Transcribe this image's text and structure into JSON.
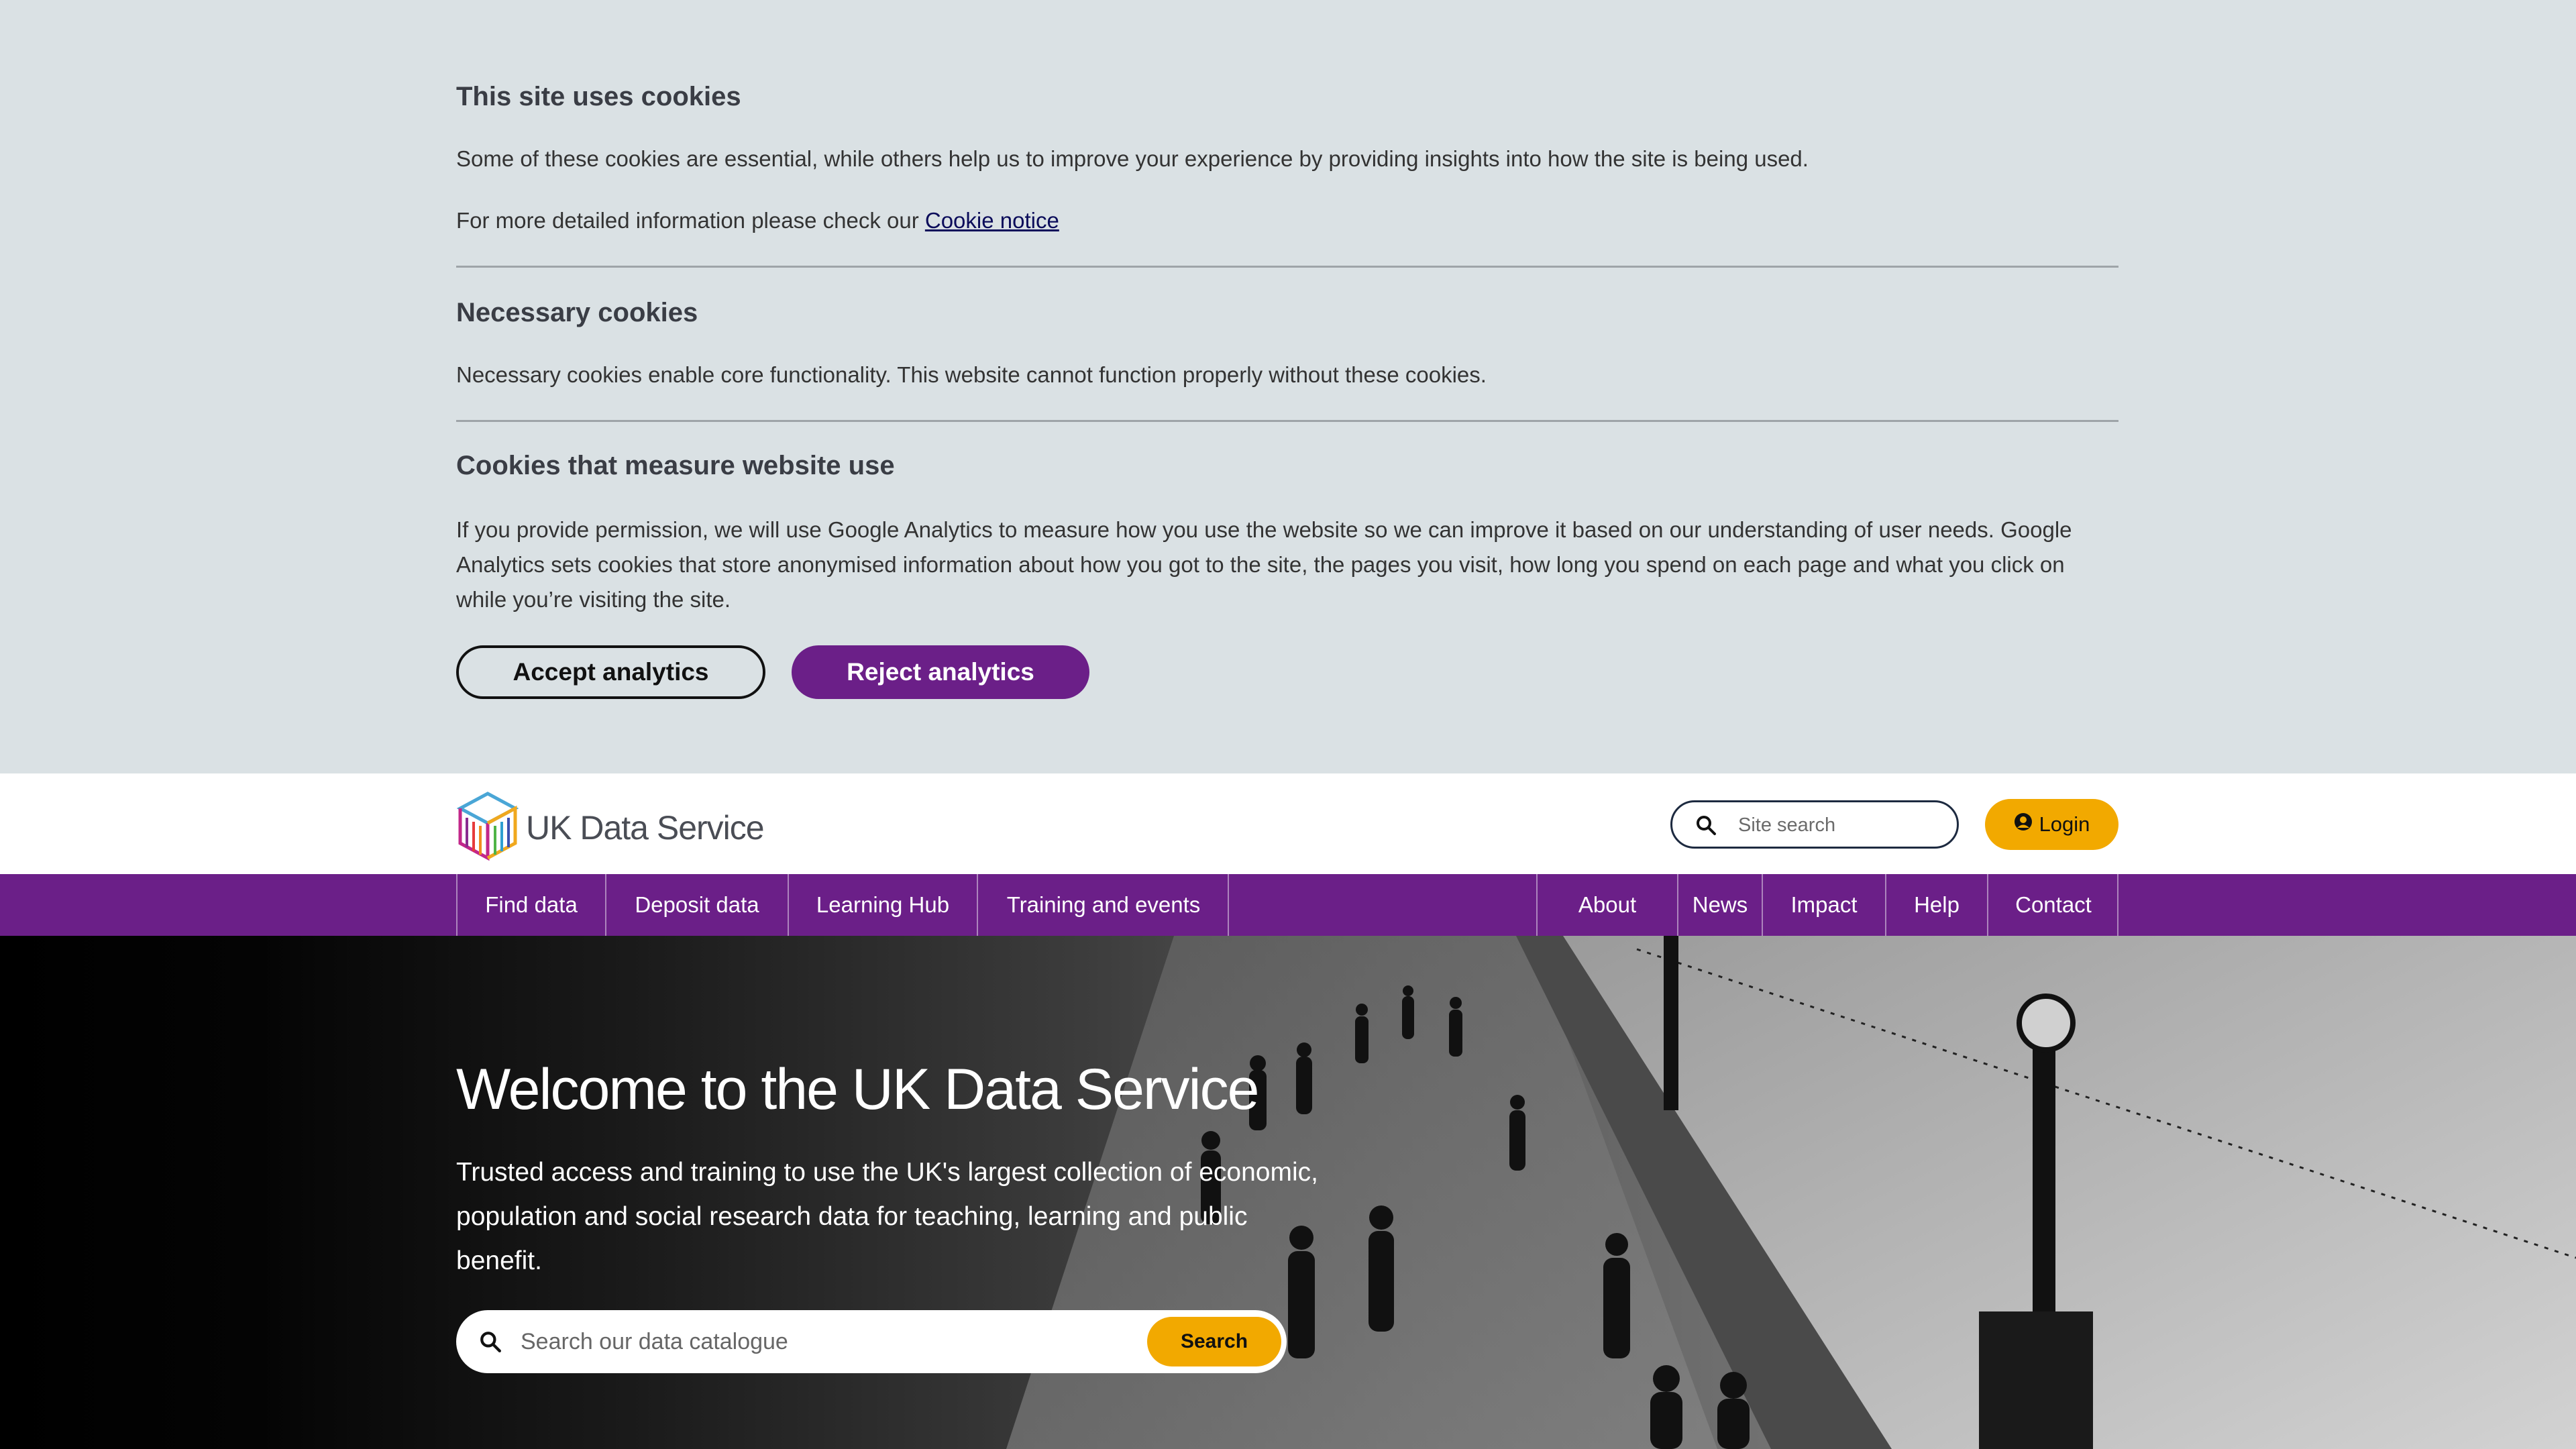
{
  "cookie_banner": {
    "title": "This site uses cookies",
    "intro": "Some of these cookies are essential, while others help us to improve your experience by providing insights into how the site is being used.",
    "more_info_prefix": "For more detailed information please check our ",
    "more_info_link": "Cookie notice",
    "necessary_title": "Necessary cookies",
    "necessary_text": "Necessary cookies enable core functionality. This website cannot function properly without these cookies.",
    "analytics_title": "Cookies that measure website use",
    "analytics_text": "If you provide permission, we will use Google Analytics to measure how you use the website so we can improve it based on our understanding of user needs. Google Analytics sets cookies that store anonymised information about how you got to the site, the pages you visit, how long you spend on each page and what you click on while you’re visiting the site.",
    "accept_label": "Accept analytics",
    "reject_label": "Reject analytics"
  },
  "header": {
    "logo_text": "UK Data Service",
    "search_placeholder": "Site search",
    "login_label": "Login"
  },
  "nav": {
    "left": [
      "Find data",
      "Deposit data",
      "Learning Hub",
      "Training and events"
    ],
    "right": [
      "About",
      "News",
      "Impact",
      "Help",
      "Contact"
    ]
  },
  "hero": {
    "title": "Welcome to the UK Data Service",
    "text": "Trusted access and training to use the UK's largest collection of economic, population and social research data for teaching, learning and public benefit.",
    "search_placeholder": "Search our data catalogue",
    "search_button": "Search"
  },
  "colors": {
    "banner_bg": "#dae1e4",
    "brand_purple": "#6b1f88",
    "accent_yellow": "#f2a900"
  },
  "icons": [
    "search-icon",
    "user-circle-icon",
    "logo-cube-icon"
  ]
}
